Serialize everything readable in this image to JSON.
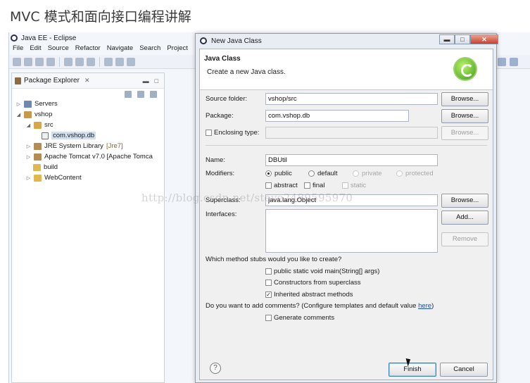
{
  "page_title": "MVC 模式和面向接口编程讲解",
  "eclipse": {
    "title": "Java EE - Eclipse",
    "menu": [
      "File",
      "Edit",
      "Source",
      "Refactor",
      "Navigate",
      "Search",
      "Project"
    ]
  },
  "package_explorer": {
    "tab_label": "Package Explorer",
    "close_glyph": "✕",
    "tree": {
      "servers": "Servers",
      "vshop": "vshop",
      "src": "src",
      "package": "com.vshop.db",
      "jre": "JRE System Library",
      "jre_decor": "[Jre7]",
      "tomcat": "Apache Tomcat v7.0 [Apache Tomca",
      "build": "build",
      "webcontent": "WebContent"
    }
  },
  "dialog": {
    "title": "New Java Class",
    "banner_title": "Java Class",
    "banner_subtitle": "Create a new Java class.",
    "source_folder_label": "Source folder:",
    "source_folder_value": "vshop/src",
    "package_label": "Package:",
    "package_value": "com.vshop.db",
    "enclosing_type_label": "Enclosing type:",
    "name_label": "Name:",
    "name_value": "DBUtil",
    "modifiers_label": "Modifiers:",
    "modifiers": {
      "public": "public",
      "default": "default",
      "private": "private",
      "protected": "protected",
      "abstract": "abstract",
      "final": "final",
      "static": "static"
    },
    "superclass_label": "Superclass:",
    "superclass_value": "java.lang.Object",
    "interfaces_label": "Interfaces:",
    "browse_label": "Browse...",
    "add_label": "Add...",
    "remove_label": "Remove",
    "stubs_question": "Which method stubs would you like to create?",
    "stub_main": "public static void main(String[] args)",
    "stub_constructors": "Constructors from superclass",
    "stub_inherited": "Inherited abstract methods",
    "comments_question": "Do you want to add comments? (Configure templates and default value ",
    "comments_link": "here",
    "comments_close": ")",
    "generate_comments": "Generate comments",
    "finish_label": "Finish",
    "cancel_label": "Cancel",
    "help_glyph": "?"
  },
  "watermark": "http://blog.csdn.net/steve2489595970"
}
